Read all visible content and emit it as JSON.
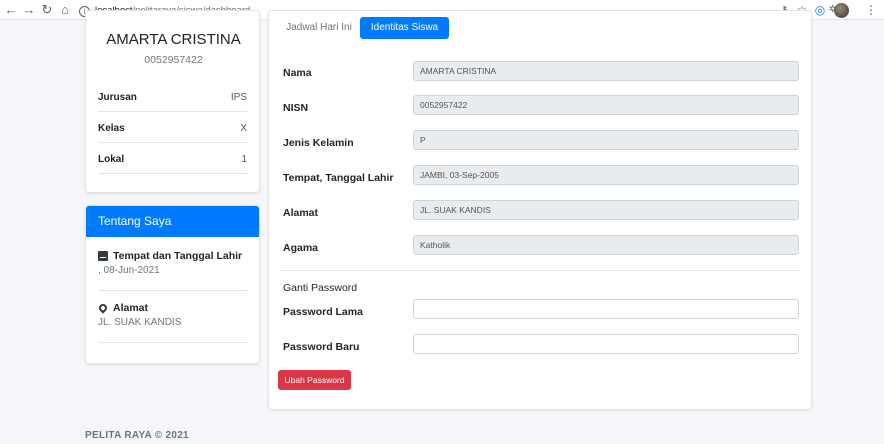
{
  "browser": {
    "url_host": "localhost",
    "url_path": "/pelitaraya/siswa/dashboard",
    "info_glyph": "i"
  },
  "profile": {
    "name": "AMARTA CRISTINA",
    "nisn": "0052957422",
    "rows": [
      {
        "label": "Jurusan",
        "value": "IPS"
      },
      {
        "label": "Kelas",
        "value": "X"
      },
      {
        "label": "Lokal",
        "value": "1"
      }
    ]
  },
  "about": {
    "title": "Tentang Saya",
    "items": [
      {
        "label": "Tempat dan Tanggal Lahir",
        "value": ", 08-Jun-2021",
        "icon": "book-icon"
      },
      {
        "label": "Alamat",
        "value": "JL. SUAK KANDIS",
        "icon": "map-marker-icon"
      }
    ]
  },
  "tabs": {
    "jadwal": "Jadwal Hari Ini",
    "identitas": "Identitas Siswa",
    "active": "identitas"
  },
  "identity": {
    "fields": [
      {
        "label": "Nama",
        "value": "AMARTA CRISTINA"
      },
      {
        "label": "NISN",
        "value": "0052957422"
      },
      {
        "label": "Jenis Kelamin",
        "value": "P"
      },
      {
        "label": "Tempat, Tanggal Lahir",
        "value": "JAMBI, 03-Sep-2005"
      },
      {
        "label": "Alamat",
        "value": "JL. SUAK KANDIS"
      },
      {
        "label": "Agama",
        "value": "Katholik"
      }
    ]
  },
  "password": {
    "section_title": "Ganti Password",
    "old_label": "Password Lama",
    "old_value": "",
    "new_label": "Password Baru",
    "new_value": "",
    "submit_label": "Ubah Password"
  },
  "footer": {
    "text": "PELITA RAYA © 2021"
  },
  "colors": {
    "primary": "#007bff",
    "danger": "#dc3545",
    "readonly_bg": "#e9ecef"
  }
}
